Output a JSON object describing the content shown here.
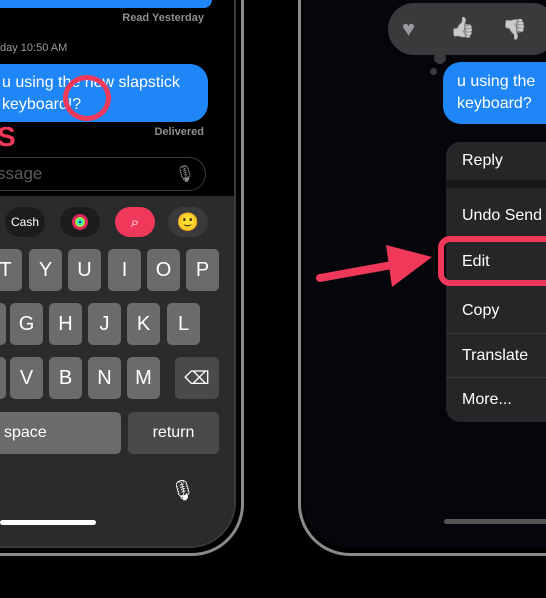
{
  "left_phone": {
    "read_status": "Read Yesterday",
    "timestamp": "day 10:50 AM",
    "message": [
      "u using the new slapstick",
      "keyboard!?"
    ],
    "delivered": "Delivered",
    "overlay_letter": "S",
    "input_placeholder": "ssage",
    "apps": {
      "cash": "Cash",
      "icons": [
        "apple-cash-icon",
        "activity-icon",
        "web-search-icon",
        "memoji-icon"
      ]
    },
    "keyboard": {
      "row1": [
        "T",
        "Y",
        "U",
        "I",
        "O",
        "P"
      ],
      "row2": [
        "G",
        "H",
        "J",
        "K",
        "L"
      ],
      "row3": [
        "V",
        "B",
        "N",
        "M"
      ],
      "space": "space",
      "return": "return"
    }
  },
  "right_phone": {
    "reactions": [
      "heart-icon",
      "thumbs-up-icon",
      "thumbs-down-icon"
    ],
    "message": [
      "u using the",
      "keyboard?"
    ],
    "menu": [
      "Reply",
      "Undo Send",
      "Edit",
      "Copy",
      "Translate",
      "More..."
    ],
    "highlighted_item": "Edit"
  },
  "colors": {
    "accent": "#f0395a",
    "bubble": "#1f86f7",
    "menu_bg": "#262628"
  }
}
